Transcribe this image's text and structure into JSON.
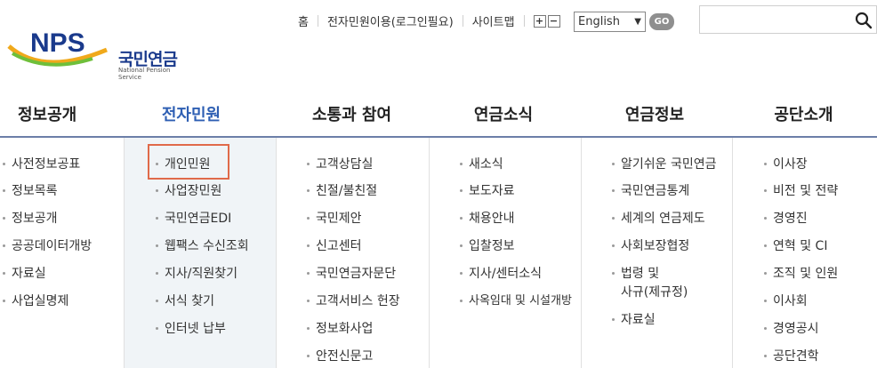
{
  "logo": {
    "brand": "NPS",
    "korean": "국민연금",
    "english": "National Pension Service"
  },
  "utility": {
    "links": [
      "홈",
      "전자민원이용(로그인필요)",
      "사이트맵"
    ],
    "zoom_in": "+",
    "zoom_out": "−"
  },
  "language": {
    "selected": "English",
    "go_label": "GO"
  },
  "search": {
    "placeholder": ""
  },
  "gnb": {
    "tabs": [
      "정보공개",
      "전자민원",
      "소통과 참여",
      "연금소식",
      "연금정보",
      "공단소개"
    ],
    "active_index": 1
  },
  "menu": {
    "col0": [
      "사전정보공표",
      "정보목록",
      "정보공개",
      "공공데이터개방",
      "자료실",
      "사업실명제"
    ],
    "col1": [
      "개인민원",
      "사업장민원",
      "국민연금EDI",
      "웹팩스 수신조회",
      "지사/직원찾기",
      "서식 찾기",
      "인터넷 납부"
    ],
    "col2": [
      "고객상담실",
      "친절/불친절",
      "국민제안",
      "신고센터",
      "국민연금자문단",
      "고객서비스 헌장",
      "정보화사업",
      "안전신문고"
    ],
    "col3": [
      "새소식",
      "보도자료",
      "채용안내",
      "입찰정보",
      "지사/센터소식",
      "사옥임대 및 시설개방"
    ],
    "col4": [
      "알기쉬운 국민연금",
      "국민연금통계",
      "세계의 연금제도",
      "사회보장협정",
      "법령 및",
      "사규(제규정)",
      "자료실"
    ],
    "col5": [
      "이사장",
      "비전 및 전략",
      "경영진",
      "연혁 및 CI",
      "조직 및 인원",
      "이사회",
      "경영공시",
      "공단견학"
    ]
  },
  "colors": {
    "accent": "#2e5fb3",
    "highlight_border": "#e06a4a"
  }
}
